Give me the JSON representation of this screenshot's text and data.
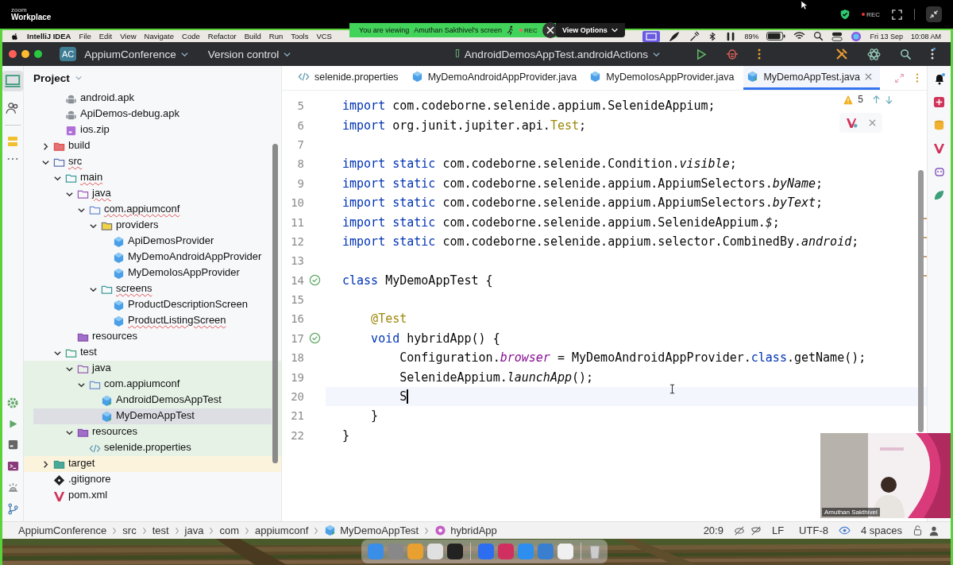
{
  "zoom_bar": {
    "logo_top": "zoom",
    "logo_bottom": "Workplace",
    "rec": "REC"
  },
  "share_banner": {
    "viewing": "You are viewing",
    "presenter": "Amuthan Sakthivel's screen",
    "rec": "REC",
    "view_options": "View Options"
  },
  "menu_bar": {
    "app": "IntelliJ IDEA",
    "items": [
      "File",
      "Edit",
      "View",
      "Navigate",
      "Code",
      "Refactor",
      "Build",
      "Run",
      "Tools",
      "VCS"
    ],
    "battery": "89%",
    "date": "Fri 13 Sep",
    "time": "10:08 AM"
  },
  "toolbar": {
    "project_badge": "AC",
    "project": "AppiumConference",
    "vcs": "Version control",
    "run_config": "AndroidDemosAppTest.androidActions"
  },
  "project_panel": {
    "title": "Project",
    "tree": [
      {
        "children": [
          {
            "label": "android.apk",
            "kind": "android",
            "selected": false,
            "typo": false,
            "test_scope": false,
            "excluded": false
          },
          {
            "label": "ApiDemos-debug.apk",
            "kind": "android",
            "selected": false,
            "typo": false,
            "test_scope": false,
            "excluded": false
          },
          {
            "label": "ios.zip",
            "kind": "zip",
            "selected": false,
            "typo": false,
            "test_scope": false,
            "excluded": false
          }
        ]
      },
      {
        "label": "build",
        "kind": "folder-excluded",
        "expanded": false,
        "selected": false,
        "typo": false,
        "test_scope": false,
        "excluded": false
      },
      {
        "label": "src",
        "kind": "folder-source",
        "expanded": true,
        "selected": false,
        "typo": true,
        "test_scope": false,
        "excluded": false,
        "children": [
          {
            "label": "main",
            "kind": "folder",
            "expanded": true,
            "selected": false,
            "typo": true,
            "test_scope": false,
            "excluded": false,
            "children": [
              {
                "label": "java",
                "kind": "folder-java",
                "expanded": true,
                "selected": false,
                "typo": true,
                "test_scope": false,
                "excluded": false,
                "children": [
                  {
                    "label": "com.appiumconf",
                    "kind": "package",
                    "expanded": true,
                    "selected": false,
                    "typo": true,
                    "test_scope": false,
                    "excluded": false,
                    "children": [
                      {
                        "label": "providers",
                        "kind": "folder-package",
                        "expanded": true,
                        "selected": false,
                        "typo": false,
                        "test_scope": false,
                        "excluded": false,
                        "children": [
                          {
                            "label": "ApiDemosProvider",
                            "kind": "class",
                            "selected": false,
                            "typo": false,
                            "test_scope": false,
                            "excluded": false
                          },
                          {
                            "label": "MyDemoAndroidAppProvider",
                            "kind": "class",
                            "selected": false,
                            "typo": false,
                            "test_scope": false,
                            "excluded": false
                          },
                          {
                            "label": "MyDemoIosAppProvider",
                            "kind": "class",
                            "selected": false,
                            "typo": false,
                            "test_scope": false,
                            "excluded": false
                          }
                        ]
                      },
                      {
                        "label": "screens",
                        "kind": "folder",
                        "expanded": true,
                        "selected": false,
                        "typo": true,
                        "test_scope": false,
                        "excluded": false,
                        "children": [
                          {
                            "label": "ProductDescriptionScreen",
                            "kind": "class",
                            "selected": false,
                            "typo": false,
                            "test_scope": false,
                            "excluded": false
                          },
                          {
                            "label": "ProductListingScreen",
                            "kind": "class",
                            "selected": false,
                            "typo": true,
                            "test_scope": false,
                            "excluded": false
                          }
                        ]
                      }
                    ]
                  }
                ]
              },
              {
                "label": "resources",
                "kind": "folder-resources",
                "selected": false,
                "typo": false,
                "test_scope": false,
                "excluded": false
              }
            ]
          },
          {
            "label": "test",
            "kind": "folder-test",
            "expanded": true,
            "selected": false,
            "typo": false,
            "test_scope": false,
            "excluded": false,
            "children": [
              {
                "label": "java",
                "kind": "folder-java",
                "expanded": true,
                "selected": false,
                "typo": false,
                "test_scope": true,
                "excluded": false,
                "children": [
                  {
                    "label": "com.appiumconf",
                    "kind": "package",
                    "expanded": true,
                    "selected": false,
                    "typo": false,
                    "test_scope": true,
                    "excluded": false,
                    "children": [
                      {
                        "label": "AndroidDemosAppTest",
                        "kind": "test-class",
                        "selected": false,
                        "typo": false,
                        "test_scope": true,
                        "excluded": false
                      },
                      {
                        "label": "MyDemoAppTest",
                        "kind": "test-class",
                        "selected": true,
                        "typo": false,
                        "test_scope": true,
                        "excluded": false
                      }
                    ]
                  }
                ]
              },
              {
                "label": "resources",
                "kind": "folder-resources",
                "expanded": true,
                "selected": false,
                "typo": false,
                "test_scope": true,
                "excluded": false,
                "children": [
                  {
                    "label": "selenide.properties",
                    "kind": "properties",
                    "selected": false,
                    "typo": false,
                    "test_scope": true,
                    "excluded": false
                  }
                ]
              }
            ]
          }
        ]
      },
      {
        "label": "target",
        "kind": "folder-target",
        "expanded": false,
        "selected": false,
        "typo": false,
        "test_scope": false,
        "excluded": true
      },
      {
        "label": ".gitignore",
        "kind": "git",
        "selected": false,
        "typo": false,
        "test_scope": false,
        "excluded": false
      },
      {
        "label": "pom.xml",
        "kind": "maven",
        "selected": false,
        "typo": false,
        "test_scope": false,
        "excluded": false
      }
    ]
  },
  "editor": {
    "tabs": [
      {
        "label": "selenide.properties",
        "kind": "properties",
        "selected": false
      },
      {
        "label": "MyDemoAndroidAppProvider.java",
        "kind": "class",
        "selected": false
      },
      {
        "label": "MyDemoIosAppProvider.java",
        "kind": "class",
        "selected": false
      },
      {
        "label": "MyDemoAppTest.java",
        "kind": "test-class",
        "selected": true
      }
    ],
    "warnings": "5",
    "lines": [
      {
        "number": "5",
        "current": false,
        "run_mark": false,
        "tokens": [
          {
            "t": "import",
            "kind": "kw"
          },
          {
            "t": " com.codeborne.selenide.appium.SelenideAppium;",
            "kind": "plain"
          }
        ]
      },
      {
        "number": "6",
        "current": false,
        "run_mark": false,
        "tokens": [
          {
            "t": "import",
            "kind": "kw"
          },
          {
            "t": " org.junit.jupiter.api.",
            "kind": "plain"
          },
          {
            "t": "Test",
            "kind": "ann"
          },
          {
            "t": ";",
            "kind": "plain"
          }
        ]
      },
      {
        "number": "7",
        "current": false,
        "run_mark": false
      },
      {
        "number": "8",
        "current": false,
        "run_mark": false,
        "tokens": [
          {
            "t": "import static",
            "kind": "kw"
          },
          {
            "t": " com.codeborne.selenide.Condition.",
            "kind": "plain"
          },
          {
            "t": "visible",
            "kind": "italic"
          },
          {
            "t": ";",
            "kind": "plain"
          }
        ]
      },
      {
        "number": "9",
        "current": false,
        "run_mark": false,
        "tokens": [
          {
            "t": "import static",
            "kind": "kw"
          },
          {
            "t": " com.codeborne.selenide.appium.AppiumSelectors.",
            "kind": "plain"
          },
          {
            "t": "byName",
            "kind": "italic"
          },
          {
            "t": ";",
            "kind": "plain"
          }
        ]
      },
      {
        "number": "10",
        "current": false,
        "run_mark": false,
        "tokens": [
          {
            "t": "import static",
            "kind": "kw"
          },
          {
            "t": " com.codeborne.selenide.appium.AppiumSelectors.",
            "kind": "plain"
          },
          {
            "t": "byText",
            "kind": "italic"
          },
          {
            "t": ";",
            "kind": "plain"
          }
        ]
      },
      {
        "number": "11",
        "current": false,
        "run_mark": false,
        "tokens": [
          {
            "t": "import static",
            "kind": "kw"
          },
          {
            "t": " com.codeborne.selenide.appium.SelenideAppium.",
            "kind": "plain"
          },
          {
            "t": "$",
            "kind": "italic"
          },
          {
            "t": ";",
            "kind": "plain"
          }
        ]
      },
      {
        "number": "12",
        "current": false,
        "run_mark": false,
        "tokens": [
          {
            "t": "import static",
            "kind": "kw"
          },
          {
            "t": " com.codeborne.selenide.appium.selector.CombinedBy.",
            "kind": "plain"
          },
          {
            "t": "android",
            "kind": "italic"
          },
          {
            "t": ";",
            "kind": "plain"
          }
        ]
      },
      {
        "number": "13",
        "current": false,
        "run_mark": false
      },
      {
        "number": "14",
        "current": false,
        "run_mark": true,
        "tokens": [
          {
            "t": "class",
            "kind": "kw"
          },
          {
            "t": " MyDemoAppTest {",
            "kind": "plain"
          }
        ]
      },
      {
        "number": "15",
        "current": false,
        "run_mark": false
      },
      {
        "number": "16",
        "current": false,
        "run_mark": false,
        "tokens": [
          {
            "t": "    @Test",
            "kind": "ann"
          }
        ]
      },
      {
        "number": "17",
        "current": false,
        "run_mark": true,
        "tokens": [
          {
            "t": "    void",
            "kind": "kw"
          },
          {
            "t": " hybridApp() {",
            "kind": "plain"
          }
        ]
      },
      {
        "number": "18",
        "current": false,
        "run_mark": false,
        "tokens": [
          {
            "t": "        Configuration.",
            "kind": "plain"
          },
          {
            "t": "browser",
            "kind": "field"
          },
          {
            "t": " = MyDemoAndroidAppProvider.",
            "kind": "plain"
          },
          {
            "t": "class",
            "kind": "kw"
          },
          {
            "t": ".getName();",
            "kind": "plain"
          }
        ]
      },
      {
        "number": "19",
        "current": false,
        "run_mark": false,
        "tokens": [
          {
            "t": "        SelenideAppium.",
            "kind": "plain"
          },
          {
            "t": "launchApp",
            "kind": "italic"
          },
          {
            "t": "();",
            "kind": "plain"
          }
        ]
      },
      {
        "number": "20",
        "current": true,
        "run_mark": false,
        "tokens": [
          {
            "t": "        S",
            "kind": "plain"
          }
        ]
      },
      {
        "number": "21",
        "current": false,
        "run_mark": false,
        "tokens": [
          {
            "t": "    }",
            "kind": "plain"
          }
        ]
      },
      {
        "number": "22",
        "current": false,
        "run_mark": false,
        "tokens": [
          {
            "t": "}",
            "kind": "plain"
          }
        ]
      }
    ]
  },
  "video": {
    "name": "Amuthan Sakthivel"
  },
  "status_bar": {
    "breadcrumbs": [
      {
        "label": "AppiumConference"
      },
      {
        "label": "src"
      },
      {
        "label": "test"
      },
      {
        "label": "java"
      },
      {
        "label": "com"
      },
      {
        "label": "appiumconf"
      },
      {
        "label": "MyDemoAppTest",
        "kind": "test-class"
      },
      {
        "label": "hybridApp",
        "kind": "method"
      }
    ],
    "position": "20:9",
    "line_separator": "LF",
    "encoding": "UTF-8",
    "indent": "4 spaces"
  }
}
